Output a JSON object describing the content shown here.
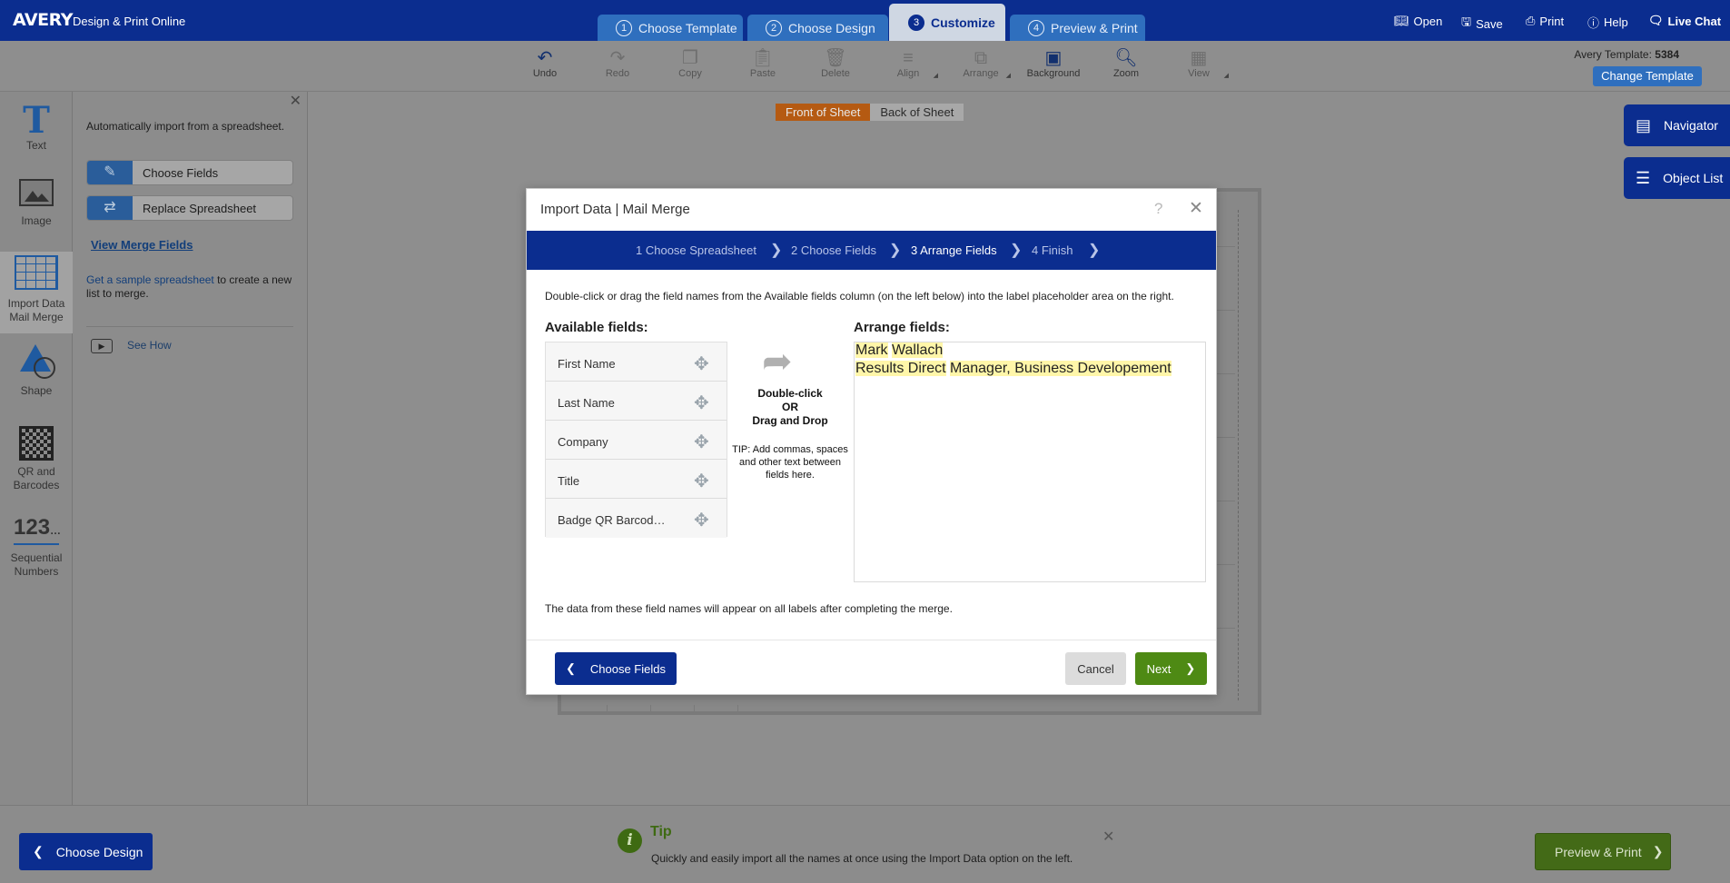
{
  "app": {
    "logo": "AVERY",
    "subtitle": "Design & Print Online"
  },
  "steps": [
    {
      "num": "1",
      "label": "Choose Template"
    },
    {
      "num": "2",
      "label": "Choose Design"
    },
    {
      "num": "3",
      "label": "Customize"
    },
    {
      "num": "4",
      "label": "Preview & Print"
    }
  ],
  "top_actions": {
    "open": "Open",
    "save": "Save",
    "print": "Print",
    "help": "Help",
    "chat": "Live Chat"
  },
  "toolbar": {
    "undo": "Undo",
    "redo": "Redo",
    "copy": "Copy",
    "paste": "Paste",
    "delete": "Delete",
    "align": "Align",
    "arrange": "Arrange",
    "background": "Background",
    "zoom": "Zoom",
    "view": "View",
    "template_label": "Avery Template:",
    "template_number": "5384",
    "change_template": "Change Template"
  },
  "rail": {
    "text": "Text",
    "image": "Image",
    "import_line1": "Import Data",
    "import_line2": "Mail Merge",
    "shape": "Shape",
    "qr_line1": "QR and",
    "qr_line2": "Barcodes",
    "seq_icon": "123",
    "seq_line1": "Sequential",
    "seq_line2": "Numbers"
  },
  "left_panel": {
    "intro": "Automatically import from a spreadsheet.",
    "choose_fields": "Choose Fields",
    "replace_spreadsheet": "Replace Spreadsheet",
    "view_merge_fields": "View Merge Fields",
    "sample_link": "Get a sample spreadsheet",
    "sample_rest": " to create a new list to merge.",
    "see_how": "See How"
  },
  "sheet_tabs": {
    "front": "Front of Sheet",
    "back": "Back of Sheet"
  },
  "right_panel": {
    "navigator": "Navigator",
    "object_list": "Object List"
  },
  "modal": {
    "title": "Import Data | Mail Merge",
    "wizard": [
      "1 Choose Spreadsheet",
      "2 Choose Fields",
      "3 Arrange Fields",
      "4 Finish"
    ],
    "instructions": "Double-click or drag the field names from the Available fields column (on the left below) into the label placeholder area on the right.",
    "available_heading": "Available fields:",
    "arrange_heading": "Arrange fields:",
    "fields": [
      "First Name",
      "Last Name",
      "Company",
      "Title",
      "Badge QR Barcod…"
    ],
    "dd_line1": "Double-click",
    "dd_line2": "OR",
    "dd_line3": "Drag and Drop",
    "tip": "TIP: Add commas, spaces and other text between fields here.",
    "arranged": {
      "first_name": "Mark",
      "last_name": "Wallach",
      "company": "Results Direct",
      "title": "Manager, Business Developement"
    },
    "note": "The data from these field names will appear on all labels after completing the merge.",
    "back_button": "Choose Fields",
    "cancel_button": "Cancel",
    "next_button": "Next"
  },
  "bottom": {
    "choose_design": "Choose Design",
    "tip_title": "Tip",
    "tip_text": "Quickly and easily import all the names at once using the Import Data option on the left.",
    "preview_print": "Preview & Print"
  }
}
